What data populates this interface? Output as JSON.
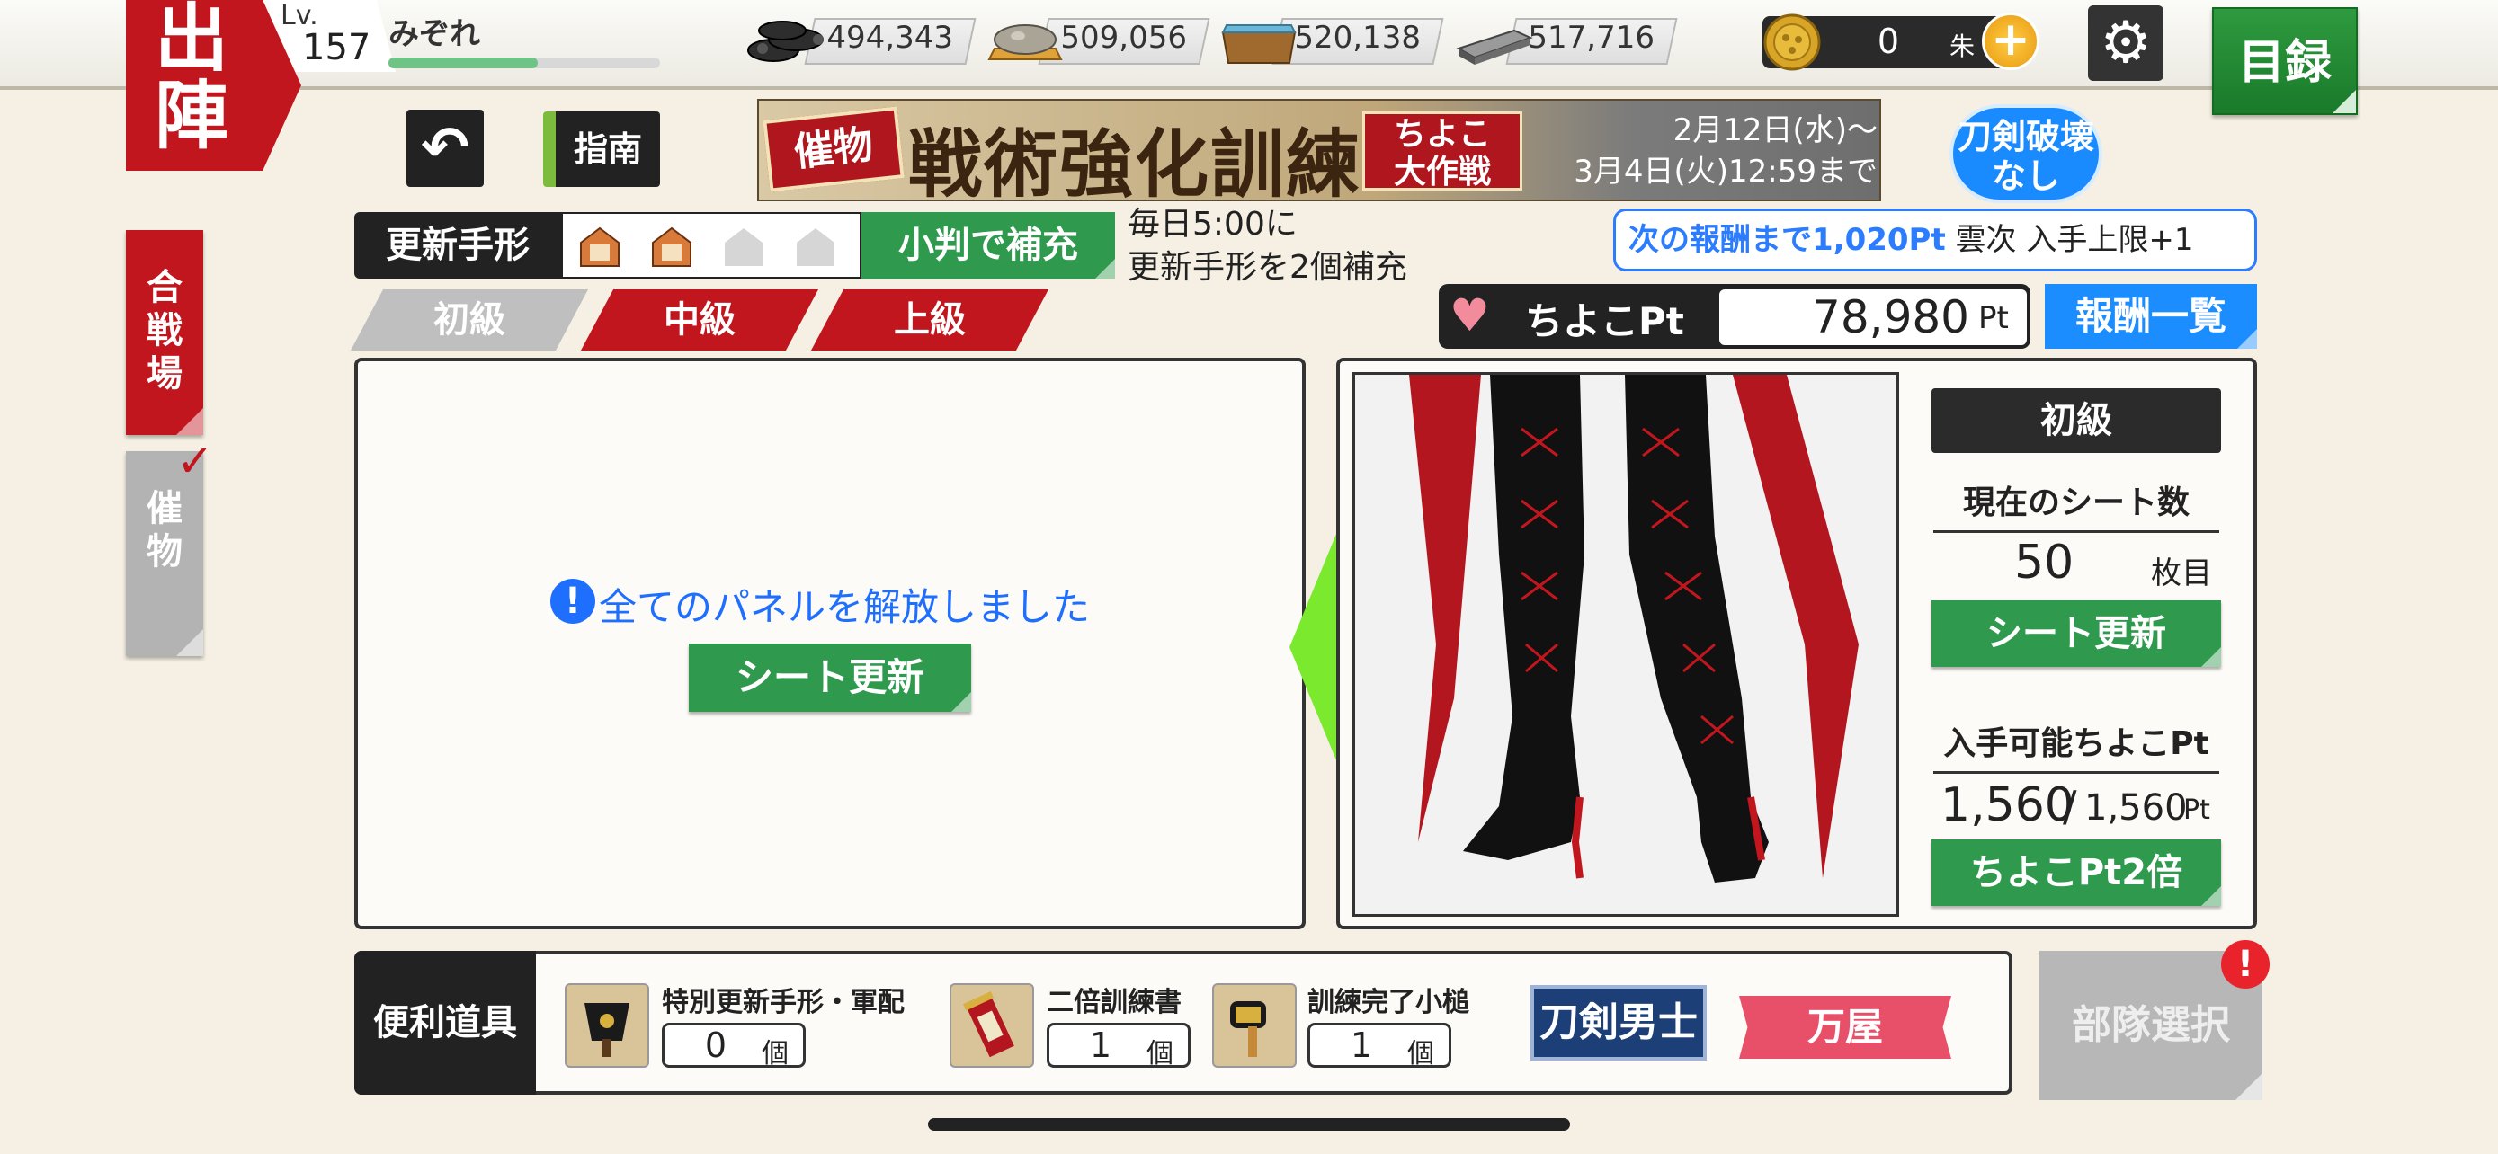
{
  "header": {
    "sortie_label": "出陣",
    "level_label": "Lv.",
    "level_value": "157",
    "player_name": "みぞれ",
    "exp_progress": 0.55,
    "resources": [
      {
        "icon": "charcoal-icon",
        "value": "494,343"
      },
      {
        "icon": "steel-ore-icon",
        "value": "509,056"
      },
      {
        "icon": "coolant-water-icon",
        "value": "520,138"
      },
      {
        "icon": "whetstone-icon",
        "value": "517,716"
      }
    ],
    "koban_value": "0",
    "koban_unit": "朱",
    "menu_label": "目録"
  },
  "side_tabs": {
    "battlefield": "合戦場",
    "event": "催物"
  },
  "subheader": {
    "guide_label": "指南",
    "banner": {
      "tag": "催物",
      "title": "戦術強化訓練",
      "subtitle_line1": "ちよこ",
      "subtitle_line2": "大作戦",
      "date_line1": "2月12日(水)～",
      "date_line2": "3月4日(火)12:59まで"
    },
    "no_break_line1": "刀剣破壊",
    "no_break_line2": "なし"
  },
  "tegata": {
    "label": "更新手形",
    "filled_slots": 2,
    "total_slots": 4,
    "refill_button": "小判で補充",
    "note_line1": "毎日5:00に",
    "note_line2": "更新手形を2個補充"
  },
  "reward": {
    "next_prefix": "次の報酬まで1,020Pt",
    "next_suffix": "雲次 入手上限+1",
    "pt_label": "ちよこPt",
    "pt_value": "78,980",
    "pt_unit": "Pt",
    "list_button": "報酬一覧"
  },
  "difficulty_tabs": [
    {
      "label": "初級",
      "active": true
    },
    {
      "label": "中級",
      "active": false
    },
    {
      "label": "上級",
      "active": false
    }
  ],
  "left_panel": {
    "message": "全てのパネルを解放しました",
    "refresh_button": "シート更新"
  },
  "right_panel": {
    "level_badge": "初級",
    "sheet_count_title": "現在のシート数",
    "sheet_count": "50",
    "sheet_unit": "枚目",
    "refresh_button": "シート更新",
    "available_title": "入手可能ちよこPt",
    "available_current": "1,560",
    "available_sep": "/",
    "available_max": "1,560",
    "available_unit": "Pt",
    "double_button": "ちよこPt2倍"
  },
  "bottom": {
    "tools_label": "便利道具",
    "items": [
      {
        "name": "特別更新手形・軍配",
        "count": "0",
        "unit": "個",
        "icon": "war-fan-icon"
      },
      {
        "name": "二倍訓練書",
        "count": "1",
        "unit": "個",
        "icon": "scroll-icon"
      },
      {
        "name": "訓練完了小槌",
        "count": "1",
        "unit": "個",
        "icon": "mallet-icon"
      }
    ],
    "touken_button": "刀剣男士",
    "yorozu_button": "万屋",
    "unit_select_button": "部隊選択",
    "alert_mark": "!"
  },
  "colors": {
    "accent_red": "#c2161e",
    "accent_green": "#2f9a4e",
    "accent_blue": "#1b8dff",
    "background": "#f5f0e3"
  }
}
